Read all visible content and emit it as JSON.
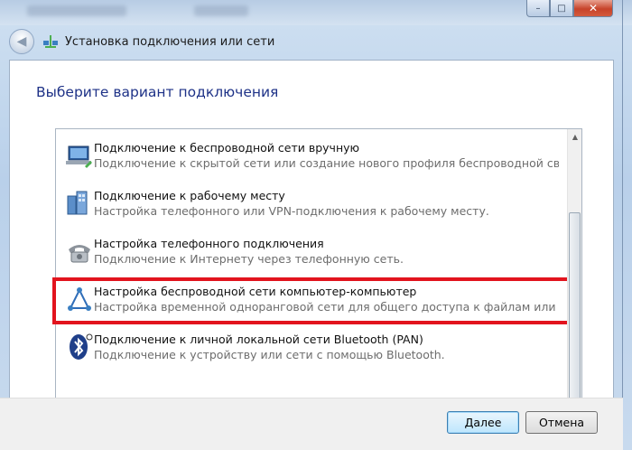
{
  "window": {
    "title": "Установка подключения или сети",
    "caption": {
      "minimize": "–",
      "maximize": "□",
      "close": "✕"
    }
  },
  "heading": "Выберите вариант подключения",
  "options": [
    {
      "icon": "manual-wireless-icon",
      "title": "Подключение к беспроводной сети вручную",
      "description": "Подключение к скрытой сети или создание нового профиля беспроводной связи."
    },
    {
      "icon": "workplace-icon",
      "title": "Подключение к рабочему месту",
      "description": "Настройка телефонного или VPN-подключения к рабочему месту."
    },
    {
      "icon": "dialup-phone-icon",
      "title": "Настройка телефонного подключения",
      "description": "Подключение к Интернету через телефонную сеть."
    },
    {
      "icon": "adhoc-network-icon",
      "title": "Настройка беспроводной сети компьютер-компьютер",
      "description": "Настройка временной одноранговой сети для общего доступа к файлам или к Инт..."
    },
    {
      "icon": "bluetooth-icon",
      "title": "Подключение к личной локальной сети Bluetooth (PAN)",
      "description": "Подключение к устройству или сети с помощью Bluetooth."
    }
  ],
  "buttons": {
    "next": "Далее",
    "cancel": "Отмена"
  },
  "colors": {
    "heading": "#1e3287",
    "highlight": "#e2141e"
  }
}
